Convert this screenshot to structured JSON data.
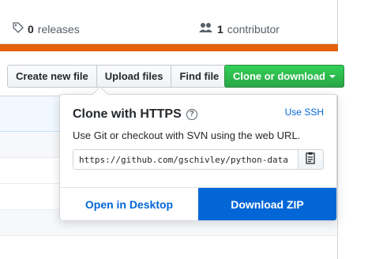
{
  "stats": {
    "releases_count": "0",
    "releases_label": "releases",
    "contributors_count": "1",
    "contributors_label": "contributor"
  },
  "buttons": {
    "create_new_file": "Create new file",
    "upload_files": "Upload files",
    "find_file": "Find file",
    "clone_or_download": "Clone or download"
  },
  "clone_panel": {
    "title": "Clone with HTTPS",
    "help_icon": "?",
    "use_ssh": "Use SSH",
    "description": "Use Git or checkout with SVN using the web URL.",
    "url": "https://github.com/gschivley/python-data",
    "open_in_desktop": "Open in Desktop",
    "download_zip": "Download ZIP"
  },
  "colors": {
    "language_bar": "#e36209",
    "clone_button": "#28a745",
    "download_zip": "#0366d6",
    "link": "#0366d6"
  },
  "icons": {
    "releases": "tag-icon",
    "contributors": "people-icon",
    "clone_caret": "chevron-down-icon",
    "copy": "clipboard-icon"
  }
}
